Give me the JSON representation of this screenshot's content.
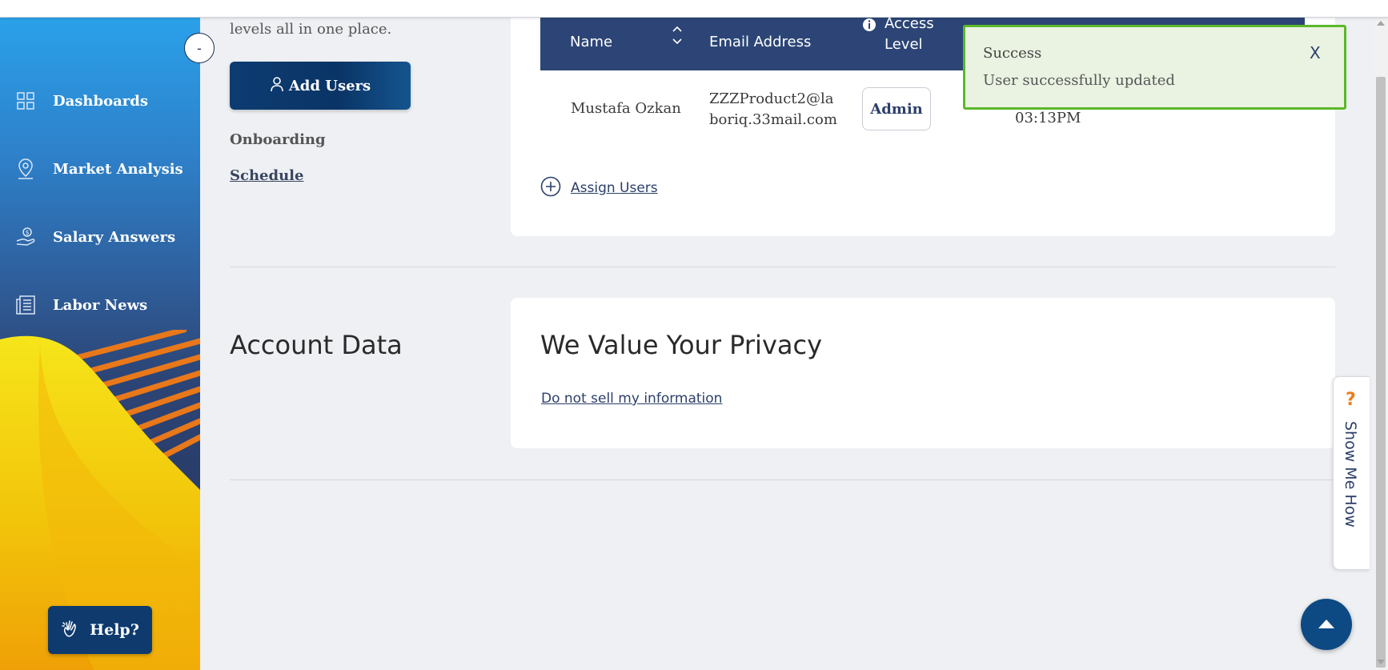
{
  "sidebar": {
    "collapse_label": "-",
    "items": [
      {
        "label": "Dashboards",
        "icon": "grid-icon"
      },
      {
        "label": "Market Analysis",
        "icon": "map-pin-icon"
      },
      {
        "label": "Salary Answers",
        "icon": "money-hand-icon"
      },
      {
        "label": "Labor News",
        "icon": "newspaper-icon"
      }
    ],
    "help_label": "Help?"
  },
  "left": {
    "intro_text": "levels all in one place.",
    "add_users_label": "Add Users",
    "onboarding_label": "Onboarding",
    "schedule_label": "Schedule",
    "account_data_title": "Account Data"
  },
  "table": {
    "headers": {
      "name": "Name",
      "email": "Email Address",
      "access_level": "Access\nLevel"
    },
    "rows": [
      {
        "name": "Mustafa Ozkan",
        "email": "ZZZProduct2@laboriq.33mail.com",
        "email_line1": "ZZZProduct2@la",
        "email_line2": "boriq.33mail.com",
        "access": "Admin",
        "time": "03:13PM",
        "trailing": "..."
      }
    ],
    "assign_label": "Assign Users"
  },
  "privacy": {
    "title": "We Value Your Privacy",
    "link": "Do not sell my information"
  },
  "toast": {
    "title": "Success",
    "message": "User successfully updated",
    "close_label": "X",
    "border_color": "#5cb82a"
  },
  "show_me_how": {
    "label": "Show Me How",
    "icon_glyph": "?"
  },
  "colors": {
    "navy": "#2c4576",
    "accent_orange": "#f07b1a",
    "success_green": "#5cb82a"
  }
}
